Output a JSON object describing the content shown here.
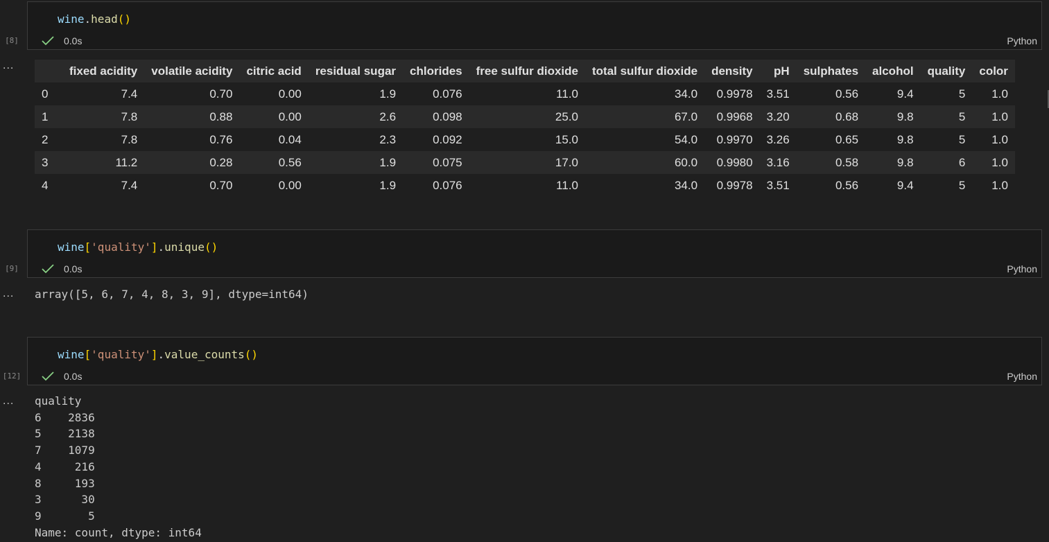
{
  "cells": [
    {
      "exec_count": "[8]",
      "code_tokens": [
        "wine",
        ".",
        "head",
        "(",
        ")"
      ],
      "status_time": "0.0s",
      "language": "Python"
    },
    {
      "exec_count": "[9]",
      "code_tokens": [
        "wine",
        "[",
        "'quality'",
        "]",
        ".",
        "unique",
        "(",
        ")"
      ],
      "status_time": "0.0s",
      "language": "Python"
    },
    {
      "exec_count": "[12]",
      "code_tokens": [
        "wine",
        "[",
        "'quality'",
        "]",
        ".",
        "value_counts",
        "(",
        ")"
      ],
      "status_time": "0.0s",
      "language": "Python"
    }
  ],
  "output_ellipsis": "...",
  "dataframe": {
    "columns": [
      "",
      "fixed acidity",
      "volatile acidity",
      "citric acid",
      "residual sugar",
      "chlorides",
      "free sulfur dioxide",
      "total sulfur dioxide",
      "density",
      "pH",
      "sulphates",
      "alcohol",
      "quality",
      "color"
    ],
    "rows": [
      [
        "0",
        "7.4",
        "0.70",
        "0.00",
        "1.9",
        "0.076",
        "11.0",
        "34.0",
        "0.9978",
        "3.51",
        "0.56",
        "9.4",
        "5",
        "1.0"
      ],
      [
        "1",
        "7.8",
        "0.88",
        "0.00",
        "2.6",
        "0.098",
        "25.0",
        "67.0",
        "0.9968",
        "3.20",
        "0.68",
        "9.8",
        "5",
        "1.0"
      ],
      [
        "2",
        "7.8",
        "0.76",
        "0.04",
        "2.3",
        "0.092",
        "15.0",
        "54.0",
        "0.9970",
        "3.26",
        "0.65",
        "9.8",
        "5",
        "1.0"
      ],
      [
        "3",
        "11.2",
        "0.28",
        "0.56",
        "1.9",
        "0.075",
        "17.0",
        "60.0",
        "0.9980",
        "3.16",
        "0.58",
        "9.8",
        "6",
        "1.0"
      ],
      [
        "4",
        "7.4",
        "0.70",
        "0.00",
        "1.9",
        "0.076",
        "11.0",
        "34.0",
        "0.9978",
        "3.51",
        "0.56",
        "9.4",
        "5",
        "1.0"
      ]
    ]
  },
  "unique_output": "array([5, 6, 7, 4, 8, 3, 9], dtype=int64)",
  "value_counts_output": [
    "quality",
    "6    2836",
    "5    2138",
    "7    1079",
    "4     216",
    "8     193",
    "3      30",
    "9       5",
    "Name: count, dtype: int64"
  ],
  "colors": {
    "background": "#1f1f1f",
    "cell_bg": "#1a1a1a",
    "check": "#89d185",
    "string": "#ce9178",
    "function": "#dcdcaa",
    "variable": "#9cdcfe"
  }
}
